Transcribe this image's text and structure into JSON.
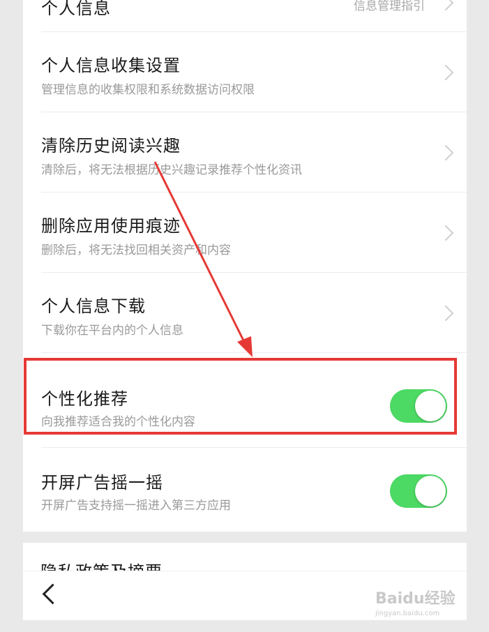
{
  "rows": [
    {
      "title": "个人信息",
      "right_text": "信息管理指引"
    },
    {
      "title": "个人信息收集设置",
      "subtitle": "管理信息的收集权限和系统数据访问权限"
    },
    {
      "title": "清除历史阅读兴趣",
      "subtitle": "清除后，将无法根据历史兴趣记录推荐个性化资讯"
    },
    {
      "title": "删除应用使用痕迹",
      "subtitle": "删除后，将无法找回相关资产和内容"
    },
    {
      "title": "个人信息下载",
      "subtitle": "下载你在平台内的个人信息"
    },
    {
      "title": "个性化推荐",
      "subtitle": "向我推荐适合我的个性化内容",
      "toggle_on": true
    },
    {
      "title": "开屏广告摇一摇",
      "subtitle": "开屏广告支持摇一摇进入第三方应用",
      "toggle_on": true
    }
  ],
  "partial_row": {
    "title": "隐私政策及摘要"
  },
  "watermark": {
    "main": "Baidu经验",
    "sub": "jingyan.baidu.com"
  },
  "colors": {
    "toggle_on": "#4cd964",
    "annotation": "#e53935"
  },
  "icons": {
    "chevron": "chevron-right-icon",
    "back": "back-arrow-icon"
  }
}
